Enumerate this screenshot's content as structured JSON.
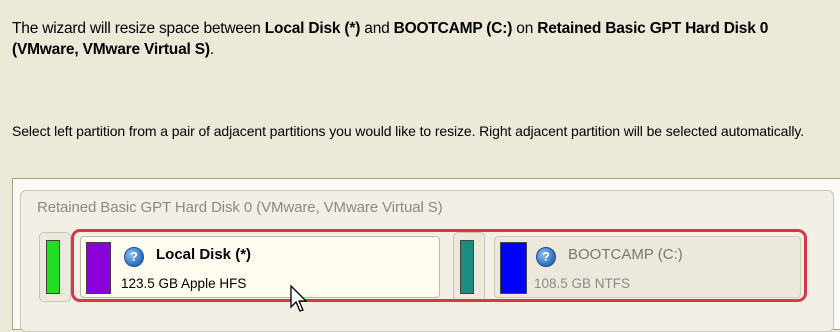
{
  "intro": {
    "prefix": "The wizard will resize space between ",
    "left_partition": "Local Disk (*)",
    "and": " and ",
    "right_partition": "BOOTCAMP (C:)",
    "on": " on ",
    "disk": "Retained Basic GPT Hard Disk 0 (VMware, VMware Virtual S)",
    "suffix": "."
  },
  "instruction": "Select left partition from a pair of adjacent partitions you would like to resize. Right adjacent partition will be selected automatically.",
  "disk_map": {
    "title": "Retained Basic GPT Hard Disk 0 (VMware, VMware Virtual S)",
    "partitions": [
      {
        "color": "#22dd22",
        "kind": "small"
      },
      {
        "name": "Local Disk (*)",
        "size": "123.5 GB Apple HFS",
        "color": "#8a00d8",
        "selected": true
      },
      {
        "color": "#1a8c82",
        "kind": "small"
      },
      {
        "name": "BOOTCAMP (C:)",
        "size": "108.5 GB NTFS",
        "color": "#0000ff",
        "selected": true
      }
    ]
  },
  "icons": {
    "help": "question-mark-icon",
    "cursor": "mouse-pointer-icon"
  },
  "colors": {
    "selection_border": "#d43a44",
    "background": "#ece9d8"
  }
}
